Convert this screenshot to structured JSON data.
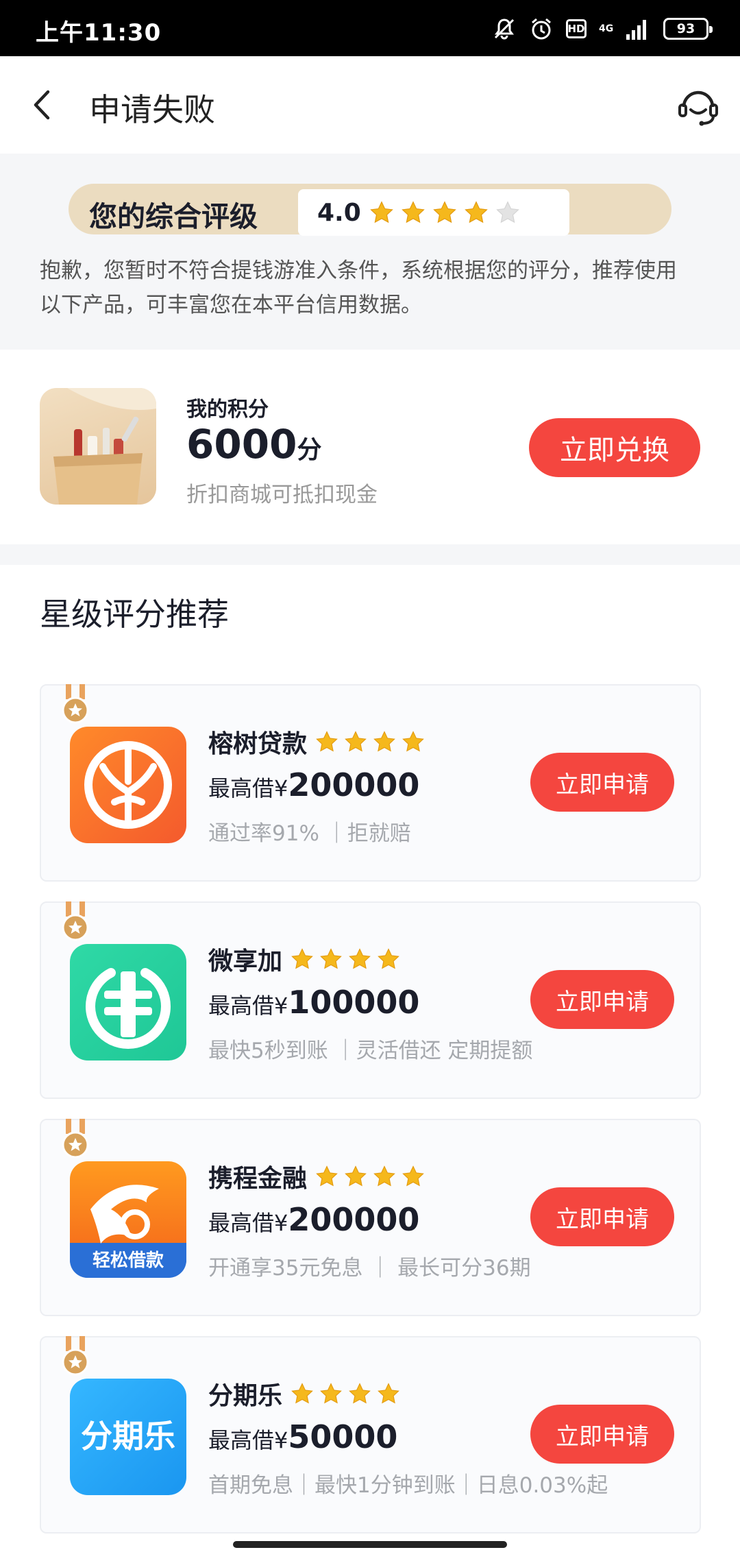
{
  "status_bar": {
    "time": "上午11:30",
    "network": "4G",
    "battery": "93"
  },
  "nav": {
    "title": "申请失败"
  },
  "rating": {
    "label": "您的综合评级",
    "score": "4.0",
    "stars_filled": 4,
    "stars_total": 5,
    "description": "抱歉，您暂时不符合提钱游准入条件，系统根据您的评分，推荐使用以下产品，可丰富您在本平台信用数据。"
  },
  "points": {
    "label": "我的积分",
    "value": "6000",
    "unit": "分",
    "subtitle": "折扣商城可抵扣现金",
    "button": "立即兑换"
  },
  "recommend": {
    "title": "星级评分推荐",
    "products": [
      {
        "name": "榕树贷款",
        "stars": 4,
        "limit_label": "最高借¥",
        "limit_value": "200000",
        "desc": "通过率91% ｜拒就赔",
        "button": "立即申请",
        "logo": "banyan-logo"
      },
      {
        "name": "微享加",
        "stars": 4,
        "limit_label": "最高借¥",
        "limit_value": "100000",
        "desc": "最快5秒到账 ｜灵活借还 定期提额",
        "button": "立即申请",
        "logo": "weixiangjia-logo"
      },
      {
        "name": "携程金融",
        "stars": 4,
        "limit_label": "最高借¥",
        "limit_value": "200000",
        "desc": "开通享35元免息 ｜ 最长可分36期",
        "button": "立即申请",
        "logo_text": "轻松借款",
        "logo": "ctrip-dolphin-logo"
      },
      {
        "name": "分期乐",
        "stars": 4,
        "limit_label": "最高借¥",
        "limit_value": "50000",
        "desc": "首期免息｜最快1分钟到账｜日息0.03%起",
        "button": "立即申请",
        "logo_text": "分期乐",
        "logo": "fenqile-logo"
      }
    ]
  },
  "colors": {
    "accent": "#f4463f",
    "star": "#f5b81c",
    "rating_pill": "#ebdcc0"
  }
}
